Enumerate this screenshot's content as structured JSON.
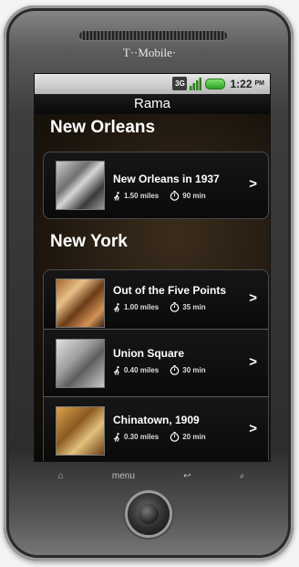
{
  "device": {
    "brand": "T··Mobile·",
    "softkeys": {
      "home": "⌂",
      "menu": "menu",
      "back": "↩",
      "search": "⌕"
    }
  },
  "status_bar": {
    "time": "1:22",
    "ampm": "PM",
    "network": "3G"
  },
  "app": {
    "title": "Rama"
  },
  "sections": [
    {
      "title": "New Orleans",
      "items": [
        {
          "title": "New Orleans in 1937",
          "distance": "1.50 miles",
          "duration": "90 min",
          "chevron": ">"
        }
      ]
    },
    {
      "title": "New York",
      "items": [
        {
          "title": "Out of the Five Points",
          "distance": "1.00 miles",
          "duration": "35 min",
          "chevron": ">"
        },
        {
          "title": "Union Square",
          "distance": "0.40 miles",
          "duration": "30 min",
          "chevron": ">"
        },
        {
          "title": "Chinatown, 1909",
          "distance": "0.30 miles",
          "duration": "20 min",
          "chevron": ">"
        }
      ]
    }
  ]
}
